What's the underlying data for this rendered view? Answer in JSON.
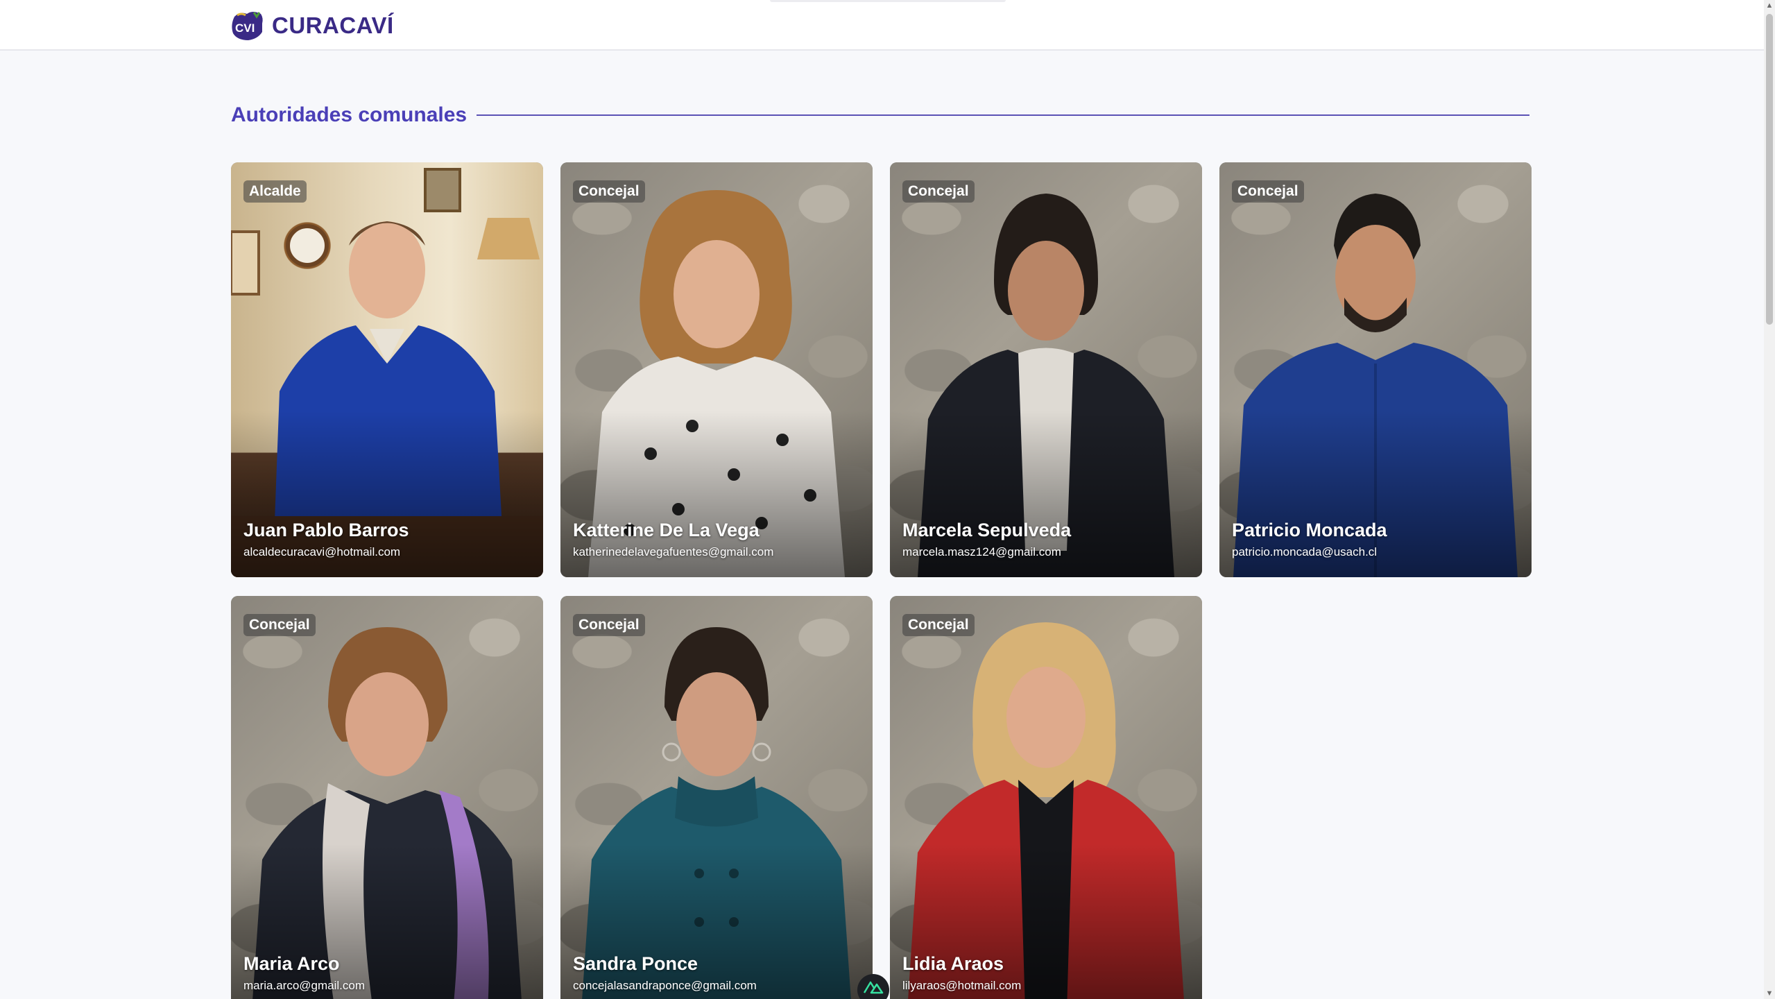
{
  "header": {
    "brand": "CURACAVÍ",
    "logo_text": "CVI"
  },
  "section": {
    "title": "Autoridades comunales"
  },
  "authorities": [
    {
      "role": "Alcalde",
      "name": "Juan Pablo Barros",
      "email": "alcaldecuracavi@hotmail.com"
    },
    {
      "role": "Concejal",
      "name": "Katterine De La Vega",
      "email": "katherinedelavegafuentes@gmail.com"
    },
    {
      "role": "Concejal",
      "name": "Marcela Sepulveda",
      "email": "marcela.masz124@gmail.com"
    },
    {
      "role": "Concejal",
      "name": "Patricio Moncada",
      "email": "patricio.moncada@usach.cl"
    },
    {
      "role": "Concejal",
      "name": "Maria Arco",
      "email": "maria.arco@gmail.com"
    },
    {
      "role": "Concejal",
      "name": "Sandra Ponce",
      "email": "concejalasandraponce@gmail.com"
    },
    {
      "role": "Concejal",
      "name": "Lidia Araos",
      "email": "lilyaraos@hotmail.com"
    }
  ],
  "colors": {
    "brand": "#3a2a86",
    "accent": "#4a3fb7",
    "rule": "#5b52b5"
  },
  "icons": {
    "logo": "curacavi-logo-icon",
    "badge": "nuxt-devtools-icon"
  }
}
